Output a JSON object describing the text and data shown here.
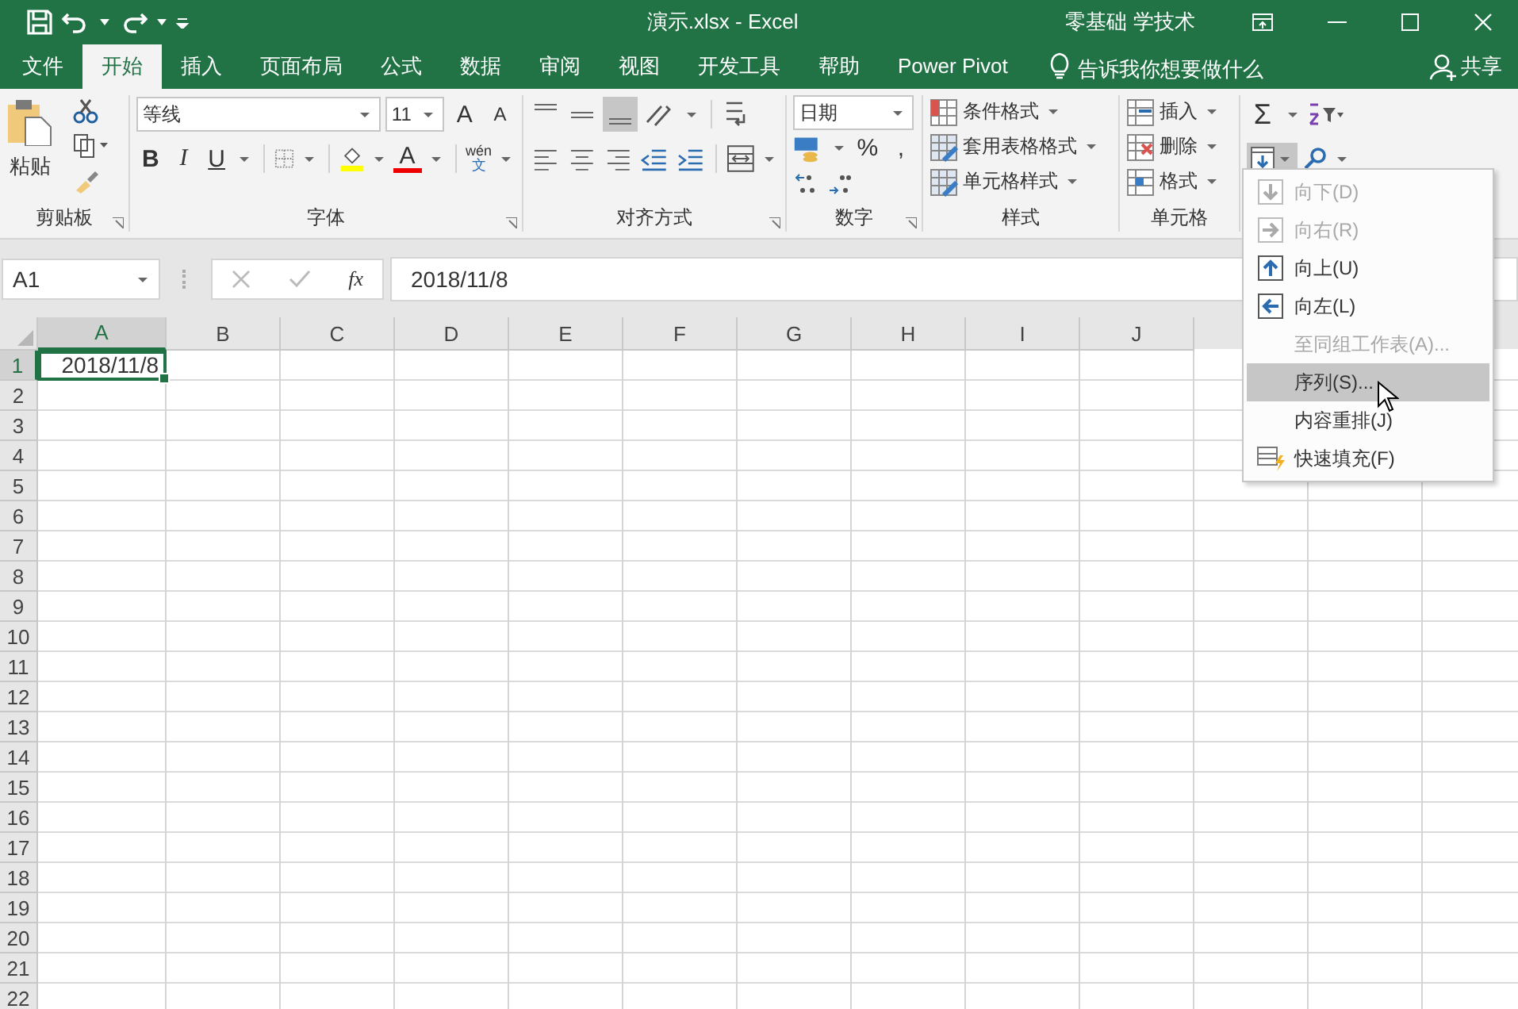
{
  "title_bar": {
    "title": "演示.xlsx  -  Excel",
    "user": "零基础 学技术"
  },
  "tabs": [
    {
      "label": "文件",
      "selected": false
    },
    {
      "label": "开始",
      "selected": true
    },
    {
      "label": "插入",
      "selected": false
    },
    {
      "label": "页面布局",
      "selected": false
    },
    {
      "label": "公式",
      "selected": false
    },
    {
      "label": "数据",
      "selected": false
    },
    {
      "label": "审阅",
      "selected": false
    },
    {
      "label": "视图",
      "selected": false
    },
    {
      "label": "开发工具",
      "selected": false
    },
    {
      "label": "帮助",
      "selected": false
    },
    {
      "label": "Power Pivot",
      "selected": false
    }
  ],
  "tell_me": {
    "placeholder": "告诉我你想要做什么"
  },
  "share": "共享",
  "ribbon": {
    "clipboard": {
      "paste": "粘贴",
      "label": "剪贴板"
    },
    "font": {
      "name": "等线",
      "size": "11",
      "grow": "A",
      "shrink": "A",
      "bold": "B",
      "italic": "I",
      "underline": "U",
      "font_color": "A",
      "phonetic": "wén",
      "phonetic_char": "文",
      "label": "字体"
    },
    "alignment": {
      "label": "对齐方式"
    },
    "number": {
      "format": "日期",
      "percent": "%",
      "comma": ",",
      "label": "数字"
    },
    "styles": {
      "items": [
        "条件格式",
        "套用表格格式",
        "单元格样式"
      ],
      "label": "样式"
    },
    "cells": {
      "items": [
        "插入",
        "删除",
        "格式"
      ],
      "label": "单元格"
    },
    "editing": {
      "autosum": "Σ",
      "fill_open": true
    }
  },
  "formula_bar": {
    "name_box": "A1",
    "fx": "fx",
    "value": "2018/11/8"
  },
  "sheet": {
    "columns": [
      {
        "label": "A",
        "selected": true
      },
      {
        "label": "B",
        "selected": false
      },
      {
        "label": "C",
        "selected": false
      },
      {
        "label": "D",
        "selected": false
      },
      {
        "label": "E",
        "selected": false
      },
      {
        "label": "F",
        "selected": false
      },
      {
        "label": "G",
        "selected": false
      },
      {
        "label": "H",
        "selected": false
      },
      {
        "label": "I",
        "selected": false
      },
      {
        "label": "J",
        "selected": false
      }
    ],
    "rows": [
      {
        "label": "1",
        "selected": true,
        "cells": [
          "2018/11/8"
        ]
      },
      {
        "label": "2",
        "selected": false
      },
      {
        "label": "3",
        "selected": false
      },
      {
        "label": "4",
        "selected": false
      },
      {
        "label": "5",
        "selected": false
      },
      {
        "label": "6",
        "selected": false
      },
      {
        "label": "7",
        "selected": false
      },
      {
        "label": "8",
        "selected": false
      },
      {
        "label": "9",
        "selected": false
      },
      {
        "label": "10",
        "selected": false
      },
      {
        "label": "11",
        "selected": false
      },
      {
        "label": "12",
        "selected": false
      },
      {
        "label": "13",
        "selected": false
      },
      {
        "label": "14",
        "selected": false
      },
      {
        "label": "15",
        "selected": false
      },
      {
        "label": "16",
        "selected": false
      },
      {
        "label": "17",
        "selected": false
      },
      {
        "label": "18",
        "selected": false
      },
      {
        "label": "19",
        "selected": false
      },
      {
        "label": "20",
        "selected": false
      },
      {
        "label": "21",
        "selected": false
      },
      {
        "label": "22",
        "selected": false
      }
    ]
  },
  "fill_menu": [
    {
      "kind": "down",
      "label": "向下(D)",
      "disabled": true,
      "selected": false
    },
    {
      "kind": "right",
      "label": "向右(R)",
      "disabled": true,
      "selected": false
    },
    {
      "kind": "up",
      "label": "向上(U)",
      "disabled": false,
      "selected": false
    },
    {
      "kind": "left",
      "label": "向左(L)",
      "disabled": false,
      "selected": false
    },
    {
      "kind": "plain",
      "label": "至同组工作表(A)...",
      "disabled": true,
      "selected": false
    },
    {
      "kind": "plain",
      "label": "序列(S)...",
      "disabled": false,
      "selected": true
    },
    {
      "kind": "plain",
      "label": "内容重排(J)",
      "disabled": false,
      "selected": false
    },
    {
      "kind": "flash",
      "label": "快速填充(F)",
      "disabled": false,
      "selected": false
    }
  ]
}
